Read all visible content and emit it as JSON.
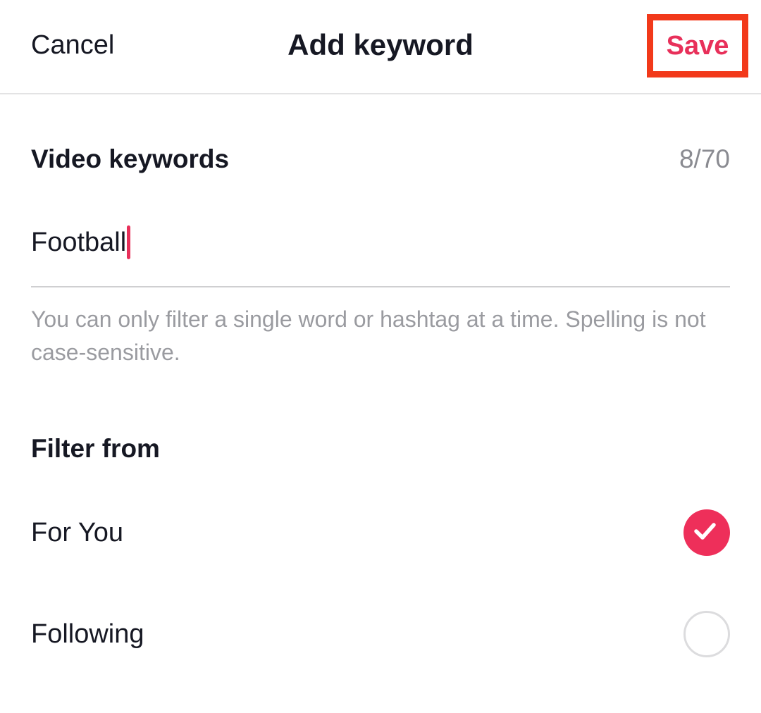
{
  "header": {
    "cancel_label": "Cancel",
    "title": "Add keyword",
    "save_label": "Save"
  },
  "keywords": {
    "section_label": "Video keywords",
    "counter": "8/70",
    "input_value": "Football",
    "hint": "You can only filter a single word or hashtag at a time. Spelling is not case-sensitive."
  },
  "filter": {
    "section_label": "Filter from",
    "options": [
      {
        "label": "For You",
        "selected": true,
        "icon": "check-icon"
      },
      {
        "label": "Following",
        "selected": false,
        "icon": "empty-circle"
      }
    ]
  },
  "colors": {
    "accent": "#ee2f5a",
    "save_text": "#e8305a",
    "highlight_box": "#f2391a",
    "secondary_text": "#8a8b91"
  }
}
